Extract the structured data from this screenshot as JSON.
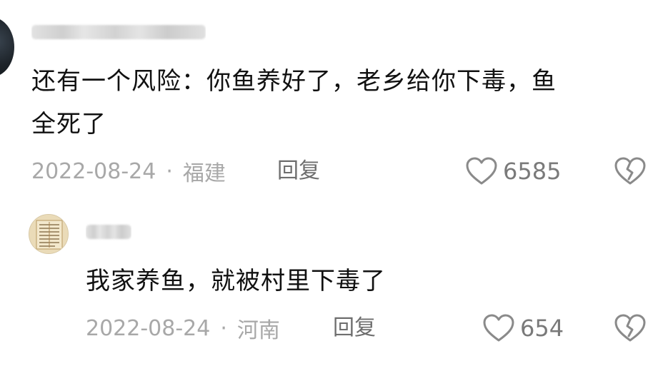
{
  "comment": {
    "text": "还有一个风险：你鱼养好了，老乡给你下毒，鱼全死了",
    "line1": "还有一个风险：你鱼养好了，老乡给你下毒，鱼",
    "line2": "全死了",
    "date": "2022-08-24",
    "separator": "·",
    "location": "福建",
    "reply_label": "回复",
    "likes": "6585",
    "like_icon": "heart-outline-icon",
    "dislike_icon": "broken-heart-icon"
  },
  "reply": {
    "text": "我家养鱼，就被村里下毒了",
    "date": "2022-08-24",
    "separator": "·",
    "location": "河南",
    "reply_label": "回复",
    "likes": "654",
    "like_icon": "heart-outline-icon",
    "dislike_icon": "broken-heart-icon"
  },
  "colors": {
    "text": "#111111",
    "meta": "#a8a8a8",
    "reply_label": "#6e6e6e",
    "like_count": "#7a7a7a",
    "icon": "#8a8a8a"
  }
}
